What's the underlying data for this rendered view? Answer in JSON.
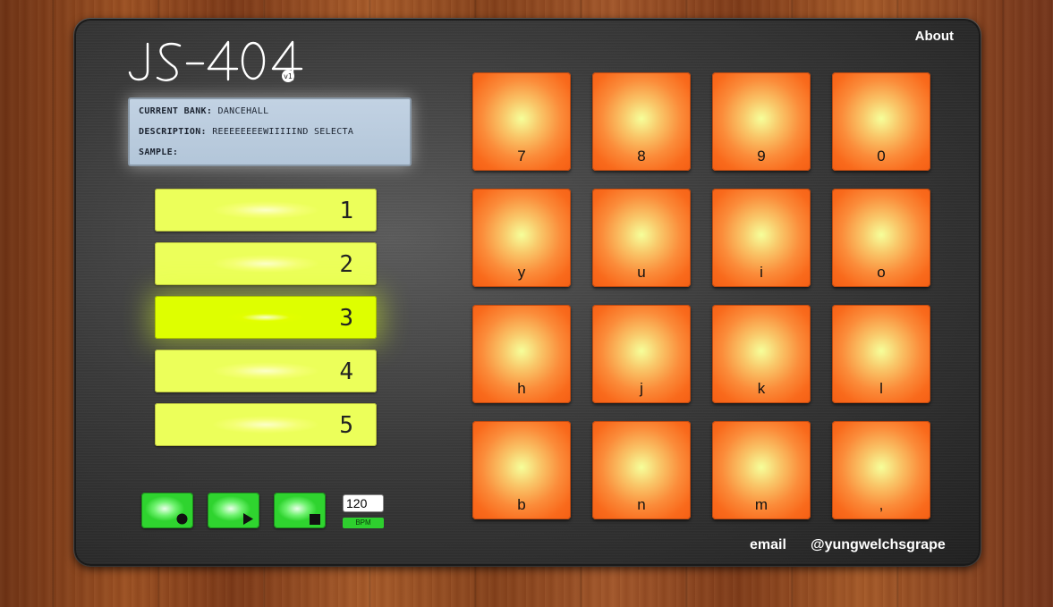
{
  "header": {
    "logo_text": "JS-404",
    "logo_badge": "v1",
    "about_label": "About"
  },
  "lcd": {
    "bank_key": "CURRENT BANK:",
    "bank_value": "DANCEHALL",
    "description_key": "DESCRIPTION:",
    "description_value": "REEEEEEEEWIIIIIND SELECTA",
    "sample_key": "SAMPLE:",
    "sample_value": ""
  },
  "banks": {
    "items": [
      {
        "label": "1",
        "active": false
      },
      {
        "label": "2",
        "active": false
      },
      {
        "label": "3",
        "active": true
      },
      {
        "label": "4",
        "active": false
      },
      {
        "label": "5",
        "active": false
      }
    ]
  },
  "transport": {
    "record_icon": "record-icon",
    "play_icon": "play-icon",
    "stop_icon": "stop-icon",
    "bpm_value": "120",
    "bpm_label": "BPM"
  },
  "pads": {
    "rows": [
      [
        "7",
        "8",
        "9",
        "0"
      ],
      [
        "y",
        "u",
        "i",
        "o"
      ],
      [
        "h",
        "j",
        "k",
        "l"
      ],
      [
        "b",
        "n",
        "m",
        ","
      ]
    ]
  },
  "footer": {
    "email_label": "email",
    "twitter_label": "@yungwelchsgrape"
  },
  "colors": {
    "pad_orange": "#f96a1c",
    "bank_yellow": "#ecff5a",
    "bank_active": "#deff00",
    "transport_green": "#2fd42f",
    "lcd_blue": "#b3c6d9"
  }
}
